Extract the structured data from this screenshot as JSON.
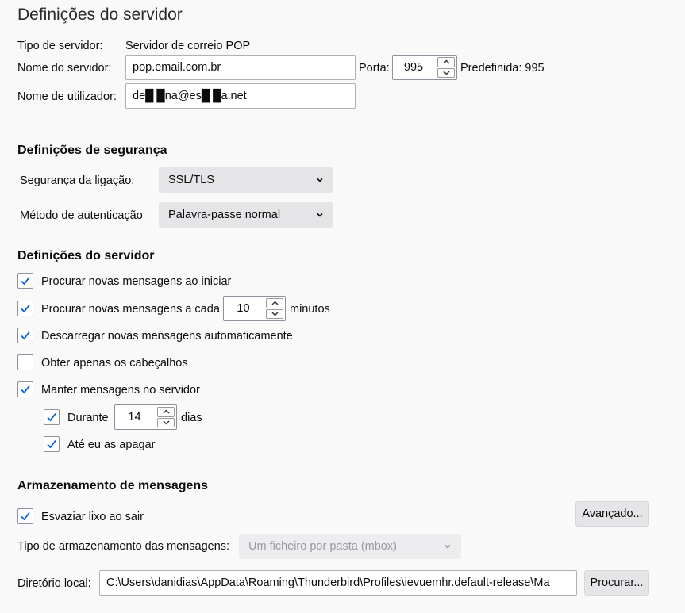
{
  "page_title": "Definições do servidor",
  "server": {
    "type_label": "Tipo de servidor:",
    "type_value": "Servidor de correio POP",
    "name_label": "Nome do servidor:",
    "name_value": "pop.email.com.br",
    "port_label": "Porta:",
    "port_value": "995",
    "default_label": "Predefinida: 995",
    "user_label": "Nome de utilizador:",
    "user_value": "de█ █na@es█ █a.net"
  },
  "security": {
    "heading": "Definições de segurança",
    "connection_label": "Segurança da ligação:",
    "connection_value": "SSL/TLS",
    "auth_label": "Método de autenticação",
    "auth_value": "Palavra-passe normal"
  },
  "settings": {
    "heading": "Definições do servidor",
    "check_on_start": {
      "label": "Procurar novas mensagens ao iniciar",
      "checked": true
    },
    "check_every": {
      "label": "Procurar novas mensagens a cada",
      "value": "10",
      "unit": "minutos",
      "checked": true
    },
    "auto_download": {
      "label": "Descarregar novas mensagens automaticamente",
      "checked": true
    },
    "headers_only": {
      "label": "Obter apenas os cabeçalhos",
      "checked": false
    },
    "leave_on_server": {
      "label": "Manter mensagens no servidor",
      "checked": true
    },
    "for_days": {
      "label": "Durante",
      "value": "14",
      "unit": "dias",
      "checked": true
    },
    "until_delete": {
      "label": "Até eu as apagar",
      "checked": true
    }
  },
  "storage": {
    "heading": "Armazenamento de mensagens",
    "empty_trash": {
      "label": "Esvaziar lixo ao sair",
      "checked": true
    },
    "advanced_label": "Avançado...",
    "type_label": "Tipo de armazenamento das mensagens:",
    "type_value": "Um ficheiro por pasta (mbox)",
    "dir_label": "Diretório local:",
    "dir_value": "C:\\Users\\danidias\\AppData\\Roaming\\Thunderbird\\Profiles\\ievuemhr.default-release\\Ma",
    "browse_label": "Procurar..."
  },
  "colors": {
    "check": "#0060df",
    "background": "#f9f9fa",
    "select_bg": "#e5e5e8"
  }
}
